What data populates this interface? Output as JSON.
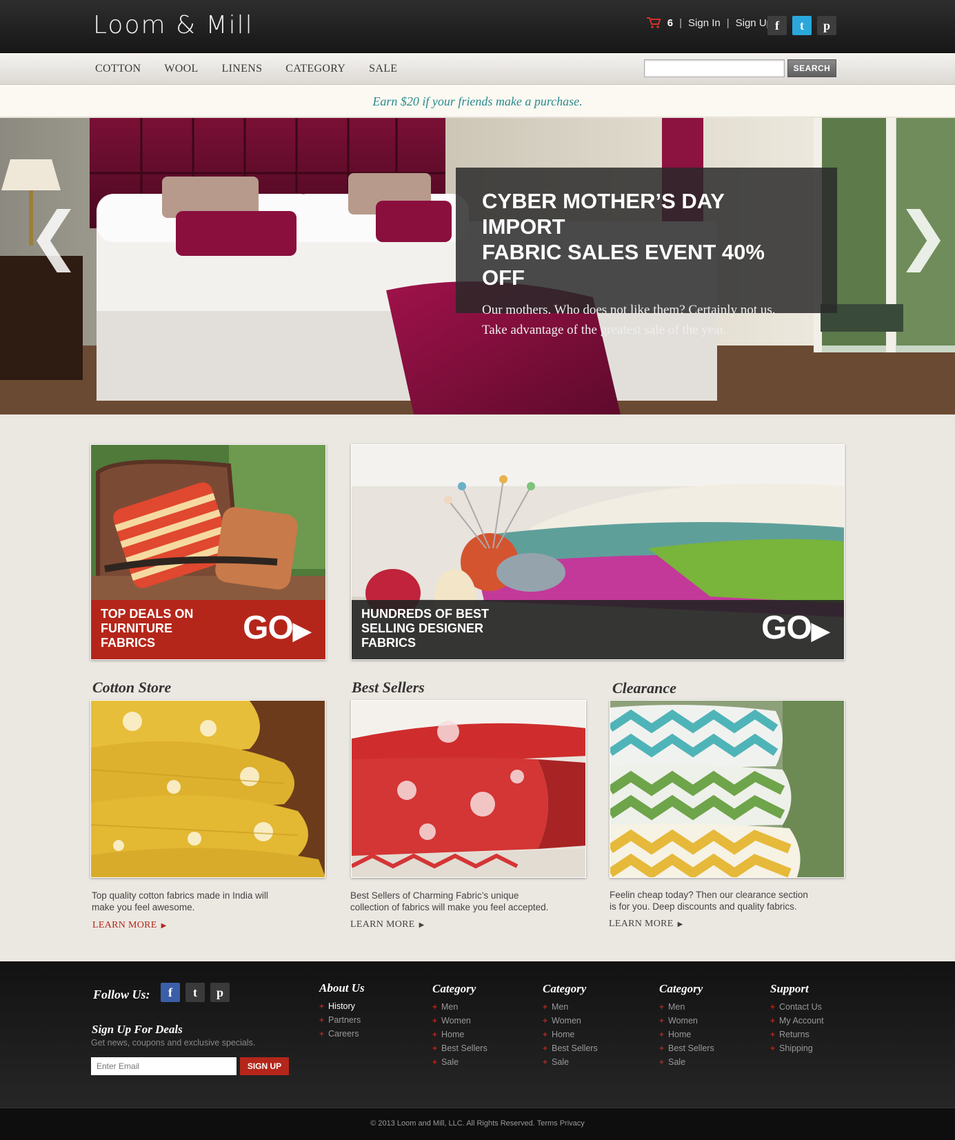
{
  "brand": {
    "logo": "Loom & Mill"
  },
  "header": {
    "cart_count": "6",
    "sign_in": "Sign In",
    "sign_up": "Sign Up",
    "social": [
      "f",
      "t",
      "p"
    ]
  },
  "nav": {
    "items": [
      "COTTON",
      "WOOL",
      "LINENS",
      "CATEGORY",
      "SALE"
    ],
    "search_placeholder": "",
    "search_button": "SEARCH"
  },
  "promo_banner": "Earn $20 if your friends make a purchase.",
  "hero": {
    "title_line1": "CYBER MOTHER’S DAY IMPORT",
    "title_line2": "FABRIC SALES EVENT 40% OFF",
    "text_line1": "Our mothers. Who does not like them? Certainly not us.",
    "text_line2": "Take advantage of the greatest sale of the year.",
    "prev": "❮",
    "next": "❯"
  },
  "promos": [
    {
      "line1": "TOP DEALS ON",
      "line2": "FURNITURE",
      "line3": "FABRICS",
      "cta": "GO",
      "band_color": "#b5261a"
    },
    {
      "line1": "HUNDREDS OF BEST",
      "line2": "SELLING DESIGNER",
      "line3": "FABRICS",
      "cta": "GO",
      "band_color": "#2c2c2c"
    }
  ],
  "stores": [
    {
      "title": "Cotton Store",
      "desc_line1": "Top quality cotton fabrics made in India will",
      "desc_line2": "make you feel awesome.",
      "link": "LEARN MORE"
    },
    {
      "title": "Best Sellers",
      "desc_line1": "Best Sellers of Charming Fabric’s unique",
      "desc_line2": "collection of fabrics will make you feel accepted.",
      "link": "LEARN MORE"
    },
    {
      "title": "Clearance",
      "desc_line1": "Feelin cheap today? Then our clearance section",
      "desc_line2": "is for you. Deep discounts and quality fabrics.",
      "link": "LEARN MORE"
    }
  ],
  "footer": {
    "follow": "Follow Us:",
    "deals_title": "Sign Up For Deals",
    "deals_sub": "Get news, coupons and exclusive specials.",
    "email_placeholder": "Enter Email",
    "signup_button": "SIGN UP",
    "columns": [
      {
        "title": "About Us",
        "items": [
          "History",
          "Partners",
          "Careers"
        ]
      },
      {
        "title": "Category",
        "items": [
          "Men",
          "Women",
          "Home",
          "Best Sellers",
          "Sale"
        ]
      },
      {
        "title": "Category",
        "items": [
          "Men",
          "Women",
          "Home",
          "Best Sellers",
          "Sale"
        ]
      },
      {
        "title": "Category",
        "items": [
          "Men",
          "Women",
          "Home",
          "Best Sellers",
          "Sale"
        ]
      },
      {
        "title": "Support",
        "items": [
          "Contact Us",
          "My Account",
          "Returns",
          "Shipping"
        ]
      }
    ],
    "copyright": "© 2013 Loom and Mill, LLC.  All Rights Reserved.  Terms  Privacy"
  },
  "colors": {
    "accent": "#b5261a",
    "teal": "#2b8a8d",
    "facebook": "#3b5ea8",
    "twitter": "#2aa8dc",
    "dark_social": "#3a3a3a"
  }
}
